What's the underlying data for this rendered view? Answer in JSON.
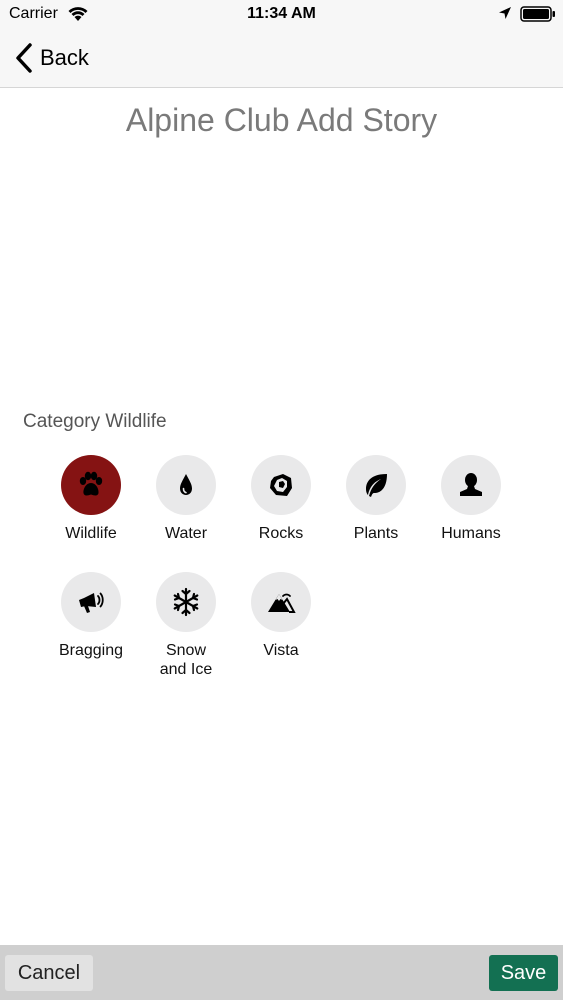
{
  "status_bar": {
    "carrier": "Carrier",
    "time": "11:34 AM",
    "icons": [
      "wifi-icon",
      "location-arrow-icon",
      "battery-icon"
    ]
  },
  "nav": {
    "back_label": "Back",
    "back_icon": "chevron-left-icon"
  },
  "title": "Alpine Club Add Story",
  "category": {
    "label": "Category Wildlife",
    "selected": "Wildlife",
    "selected_color": "#851313",
    "items": [
      {
        "label": "Wildlife",
        "icon": "paw-icon"
      },
      {
        "label": "Water",
        "icon": "water-drop-icon"
      },
      {
        "label": "Rocks",
        "icon": "rock-icon"
      },
      {
        "label": "Plants",
        "icon": "leaf-icon"
      },
      {
        "label": "Humans",
        "icon": "person-icon"
      },
      {
        "label": "Bragging",
        "icon": "megaphone-icon"
      },
      {
        "label": "Snow\nand Ice",
        "icon": "snowflake-icon"
      },
      {
        "label": "Vista",
        "icon": "mountain-icon"
      }
    ]
  },
  "toolbar": {
    "cancel_label": "Cancel",
    "save_label": "Save",
    "save_color": "#137052"
  }
}
